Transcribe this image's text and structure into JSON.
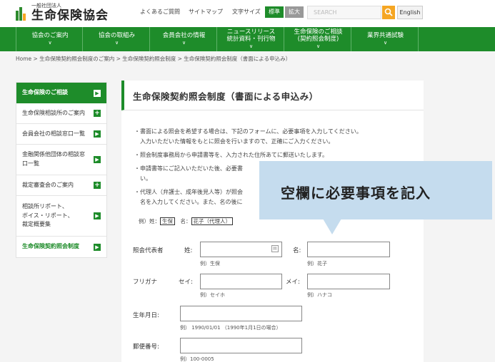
{
  "header": {
    "logo_small": "一般社団法人",
    "logo_main": "生命保険協会",
    "util_links": [
      "よくあるご質問",
      "サイトマップ",
      "文字サイズ"
    ],
    "size_standard": "標準",
    "size_large": "拡大",
    "search_placeholder": "SEARCH",
    "lang": "English",
    "colors": {
      "accent": "#1e8c2a",
      "search": "#f5a623",
      "size_large": "#999999"
    }
  },
  "nav": [
    {
      "line1": "協会のご案内",
      "line2": ""
    },
    {
      "line1": "協会の取組み",
      "line2": ""
    },
    {
      "line1": "会員会社の情報",
      "line2": ""
    },
    {
      "line1": "ニュースリリース",
      "line2": "統計資料・刊行物"
    },
    {
      "line1": "生命保険のご相談",
      "line2": "(契約照会制度)"
    },
    {
      "line1": "業界共通試験",
      "line2": ""
    }
  ],
  "breadcrumb": "Home > 生命保険契約照会制度のご案内 > 生命保険契約照会制度 > 生命保険契約照会制度（書面による申込み）",
  "sidebar": {
    "heading": "生命保険のご相談",
    "items": [
      {
        "label": "生命保険相談所のご案内",
        "marker": "plus"
      },
      {
        "label": "会員会社の相談窓口一覧",
        "marker": "arrow"
      },
      {
        "label": "金融関係他団体の相談窓\n口一覧",
        "marker": "arrow"
      },
      {
        "label": "裁定審査会のご案内",
        "marker": "plus"
      },
      {
        "label": "相談所リポート、\nボイス・リポート、\n裁定概要集",
        "marker": "arrow"
      },
      {
        "label": "生命保険契約照会制度",
        "marker": "arrow"
      }
    ]
  },
  "main": {
    "title": "生命保険契約照会制度（書面による申込み）",
    "bullets": [
      [
        "・書面による照会を希望する場合は、下記のフォームに、必要事項を入力してください。",
        "　入力いただいた情報をもとに照会を行いますので、正確にご入力ください。"
      ],
      [
        "・照会制度事務局から申請書等を、入力された住所あてに郵送いたします。"
      ],
      [
        "・申請書等にご記入いただいた後、必要書",
        "　い。"
      ],
      [
        "・代理人（弁護士、成年後見人等）が照会",
        "　名を入力してください。また、名の後に"
      ]
    ],
    "example_prefix": "例）姓：",
    "example_sei": "生保",
    "example_mid": "　名：",
    "example_mei": "花子（代理人）",
    "form": {
      "label_name": "照会代表者",
      "label_sei": "姓:",
      "label_mei": "名:",
      "hint_sei": "例）生保",
      "hint_mei": "例）花子",
      "label_kana": "フリガナ",
      "label_sei_kana": "セイ:",
      "label_mei_kana": "メイ:",
      "hint_sei_kana": "例）セイホ",
      "hint_mei_kana": "例）ハナコ",
      "label_birth": "生年月日:",
      "hint_birth": "例） 1990/01/01 （1990年1月1日の場合）",
      "label_postal": "郵便番号:",
      "hint_postal": "例）100-0005"
    }
  },
  "callout": {
    "text": "空欄に必要事項を記入"
  }
}
